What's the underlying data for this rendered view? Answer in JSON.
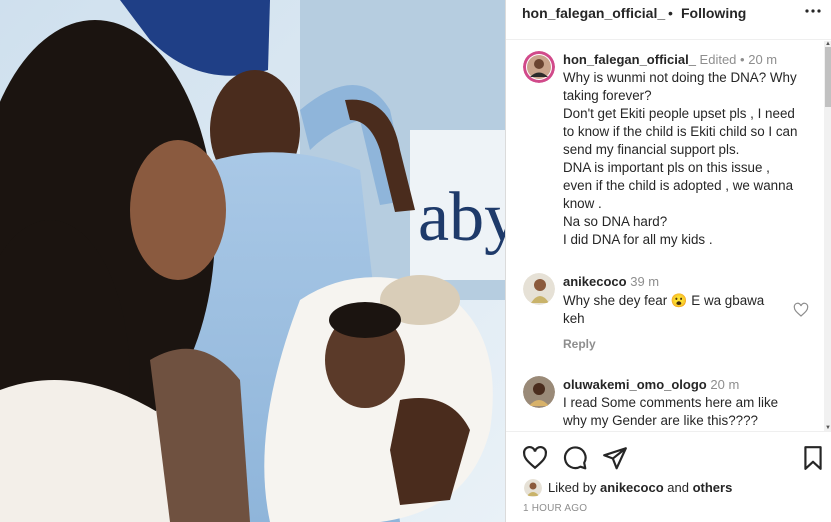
{
  "header": {
    "username": "hon_falegan_official_",
    "separator": "•",
    "follow_status": "Following",
    "more_icon": "more-horizontal-icon"
  },
  "photo": {
    "visible_text": "aby"
  },
  "caption": {
    "username": "hon_falegan_official_",
    "edited": "Edited",
    "bullet": "•",
    "time": "20 m",
    "lines": [
      "Why is wunmi not doing the DNA? Why",
      "taking forever?",
      "Don't get Ekiti people upset pls , I need",
      "to know if the child is Ekiti child so I can",
      "send my financial support pls.",
      "DNA is important pls on this issue ,",
      "even if the child is adopted , we wanna",
      "know .",
      "Na so DNA hard?",
      "I did DNA for all my kids ."
    ]
  },
  "comments": [
    {
      "username": "anikecoco",
      "time": "39 m",
      "lines": [
        "Why she dey fear 😮 E wa gbawa",
        "keh"
      ],
      "reply_label": "Reply"
    },
    {
      "username": "oluwakemi_omo_ologo",
      "time": "20 m",
      "lines": [
        "I read Some comments here am like",
        "why my Gender are like this????"
      ]
    }
  ],
  "actions": {
    "icons": [
      "heart-icon",
      "comment-icon",
      "share-icon",
      "bookmark-icon"
    ],
    "liked_prefix": "Liked by",
    "liked_user": "anikecoco",
    "liked_and": "and",
    "liked_others": "others",
    "timestamp": "1 HOUR AGO"
  },
  "colors": {
    "text": "#262626",
    "muted": "#8e8e8e",
    "border": "#dbdbdb"
  }
}
